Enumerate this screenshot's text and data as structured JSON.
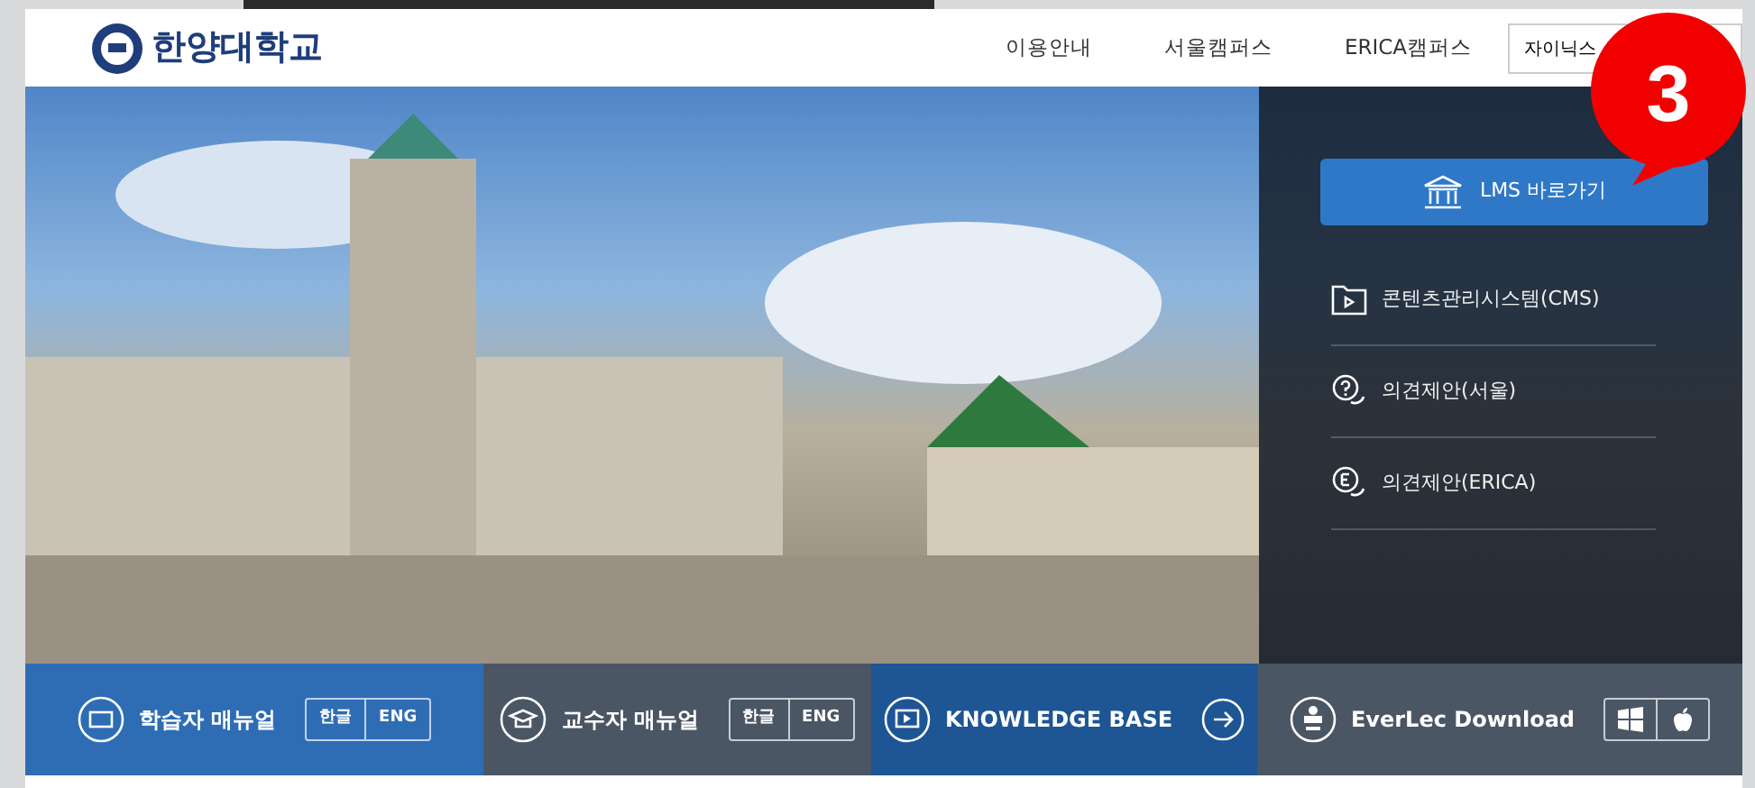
{
  "header": {
    "logo_text": "한양대학교",
    "nav": [
      {
        "label": "이용안내"
      },
      {
        "label": "서울캠퍼스"
      },
      {
        "label": "ERICA캠퍼스"
      }
    ],
    "search": {
      "value": "자이닉스"
    }
  },
  "side_panel": {
    "lms_button": "LMS 바로가기",
    "links": [
      {
        "kind": "cms",
        "label": "콘텐츠관리시스템(CMS)"
      },
      {
        "kind": "seoul",
        "label": "의견제안(서울)"
      },
      {
        "kind": "erica",
        "label": "의견제안(ERICA)"
      }
    ]
  },
  "quick_bar": [
    {
      "kind": "manual",
      "label": "학습자 매뉴얼",
      "options": [
        "한글",
        "ENG"
      ],
      "color": "#2e6db4"
    },
    {
      "kind": "manual",
      "label": "교수자 매뉴얼",
      "options": [
        "한글",
        "ENG"
      ],
      "color": "#4b5664"
    },
    {
      "kind": "link",
      "label": "KNOWLEDGE BASE",
      "color": "#1d5595"
    },
    {
      "kind": "download",
      "label": "EverLec Download",
      "color": "#4b5664"
    }
  ],
  "callout": {
    "number": "3"
  }
}
